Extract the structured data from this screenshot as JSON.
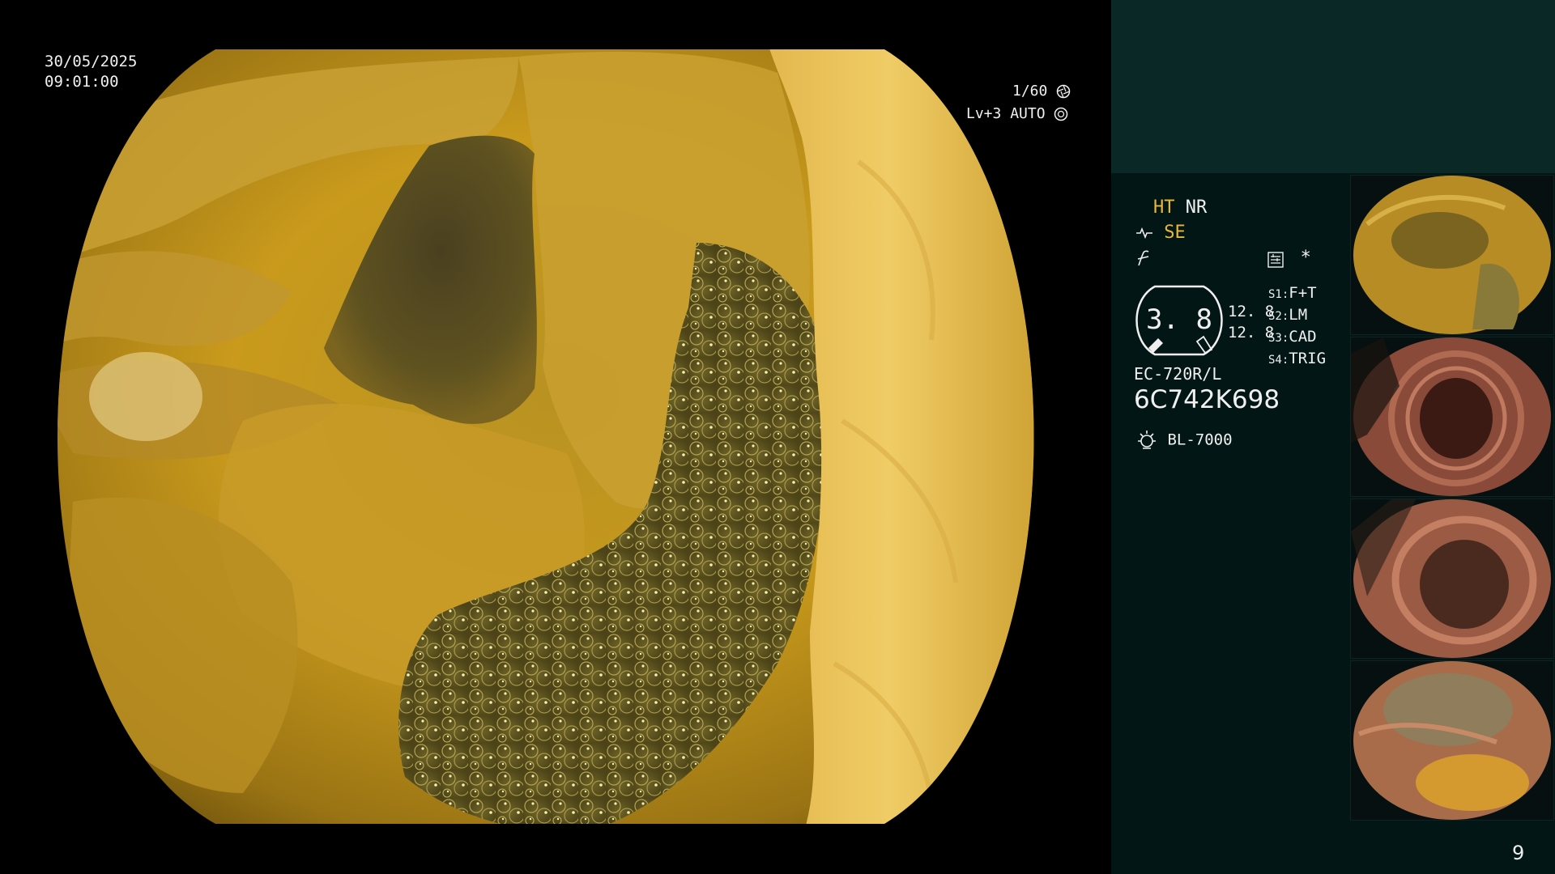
{
  "overlay": {
    "date": "30/05/2025",
    "time": "09:01:00",
    "shutter": "1/60",
    "light_level": "Lv+3",
    "iris_mode": "AUTO"
  },
  "panel": {
    "ht_label": "HT",
    "nr_label": "NR",
    "se_label": "SE",
    "magnification": "3. 8",
    "values": [
      "12. 8",
      "12. 8"
    ],
    "switches": [
      {
        "key": "S1",
        "value": "F+T"
      },
      {
        "key": "S2",
        "value": "LM"
      },
      {
        "key": "S3",
        "value": "CAD"
      },
      {
        "key": "S4",
        "value": "TRIG"
      }
    ],
    "asterisk": "*",
    "scope_model": "EC-720R/L",
    "serial": "6C742K698",
    "light_source": "BL-7000"
  },
  "page_number": "9",
  "icons": {
    "shutter": "aperture-icon",
    "iris": "iris-icon",
    "enhancement": "wave-icon",
    "structure": "structure-icon",
    "video": "video-settings-icon",
    "light": "light-source-icon"
  },
  "colors": {
    "panel_background": "#031616",
    "panel_top": "#0a2826",
    "highlight": "#e8b83a",
    "text": "#f0f0f0"
  }
}
